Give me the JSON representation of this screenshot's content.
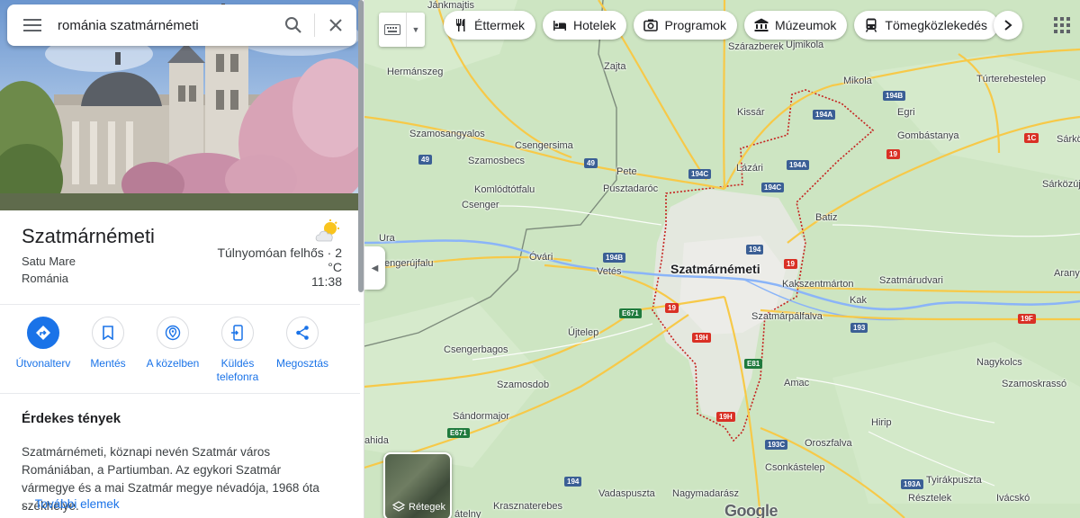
{
  "search": {
    "query": "románia szatmárnémeti"
  },
  "place": {
    "name": "Szatmárnémeti",
    "region": "Satu Mare",
    "country": "Románia",
    "weather": "Túlnyomóan felhős · 2 °C",
    "time": "11:38"
  },
  "actions": [
    {
      "label": "Útvonalterv",
      "icon": "directions-icon"
    },
    {
      "label": "Mentés",
      "icon": "bookmark-icon"
    },
    {
      "label": "A közelben",
      "icon": "nearby-icon"
    },
    {
      "label": "Küldés telefonra",
      "icon": "send-to-phone-icon"
    },
    {
      "label": "Megosztás",
      "icon": "share-icon"
    }
  ],
  "facts": {
    "heading": "Érdekes tények",
    "text": "Szatmárnémeti, köznapi nevén Szatmár város Romániában, a Partiumban. Az egykori Szatmár vármegye és a mai Szatmár megye névadója, 1968 óta székhelye.",
    "more_prefix": "...",
    "more_link": "További elemek"
  },
  "chips": [
    {
      "label": "Éttermek",
      "icon": "restaurant-icon"
    },
    {
      "label": "Hotelek",
      "icon": "hotel-icon"
    },
    {
      "label": "Programok",
      "icon": "camera-icon"
    },
    {
      "label": "Múzeumok",
      "icon": "museum-icon"
    },
    {
      "label": "Tömegközlekedés",
      "icon": "transit-icon"
    }
  ],
  "layers_label": "Rétegek",
  "google_logo": "Google",
  "map": {
    "city": "Szatmárnémeti",
    "places": [
      "Jánkmajtis",
      "Zajta",
      "Szárazberek",
      "Ujmikola",
      "Hermánszeg",
      "Mikola",
      "Kissár",
      "Egri",
      "Túrterebestelep",
      "Szamosangyalos",
      "Csengersima",
      "Gombástanya",
      "Sárköz",
      "Szamosbecs",
      "Pete",
      "Lázári",
      "Sárközújlak",
      "Komlódtótfalu",
      "Pusztadaróc",
      "Csenger",
      "Batiz",
      "Ura",
      "Óvári",
      "Vetés",
      "Kakszentmárton",
      "Szatmárudvari",
      "Aranyos",
      "Kak",
      "Újtelep",
      "Szatmárpálfalva",
      "Csengerbagos",
      "Nagykolcs",
      "Amac",
      "Szamosdob",
      "Szamoskrassó",
      "Sándormajor",
      "Hirip",
      "Oroszfalva",
      "Csonkástelep",
      "Tyirákpuszta",
      "Vadaspuszta",
      "Nagymadarász",
      "Résztelek",
      "Ivácskó",
      "Krasznaterebes",
      "ahida",
      "engerújfalu",
      "átelny"
    ],
    "shields": [
      "194B",
      "194A",
      "194A",
      "194C",
      "194C",
      "194",
      "19",
      "19",
      "49",
      "49",
      "1C",
      "194B",
      "E671",
      "19",
      "19H",
      "E81",
      "193",
      "19F",
      "E671",
      "19H",
      "193C",
      "194",
      "193A"
    ]
  }
}
